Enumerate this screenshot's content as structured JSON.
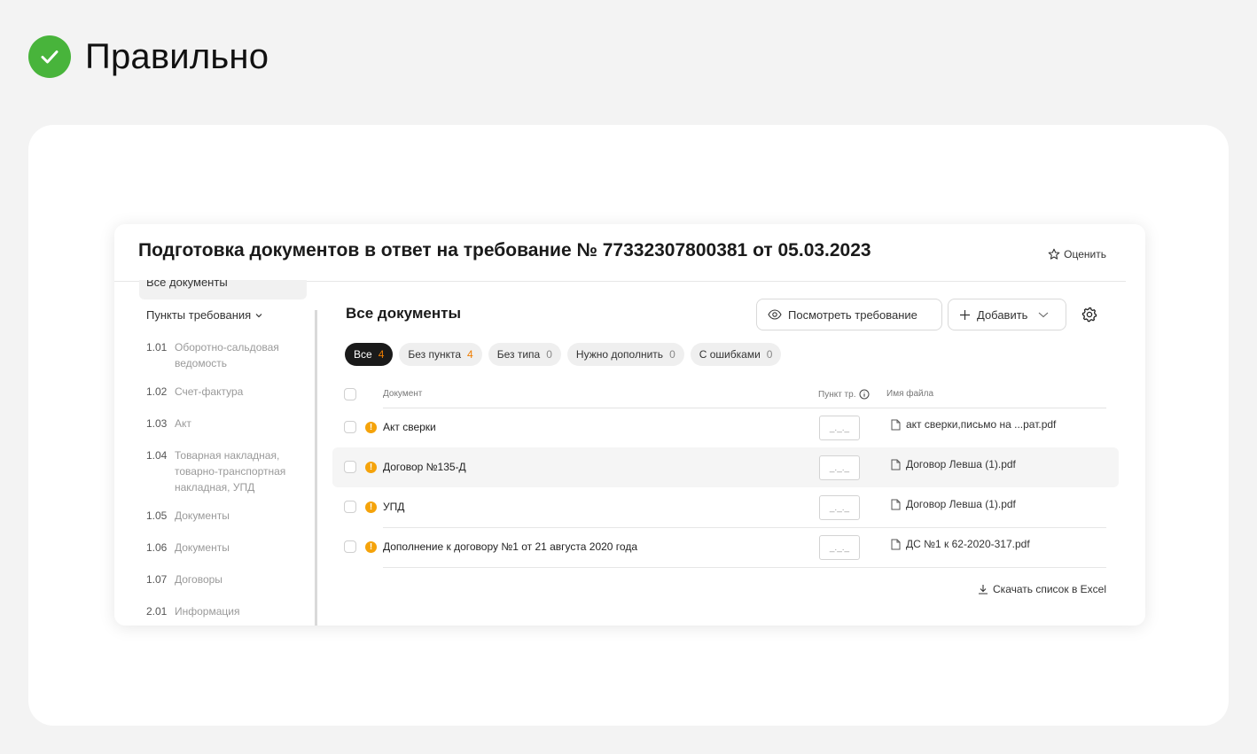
{
  "page": {
    "heading": "Правильно",
    "badge_icon": "check-icon",
    "badge_color": "#48b43b"
  },
  "window": {
    "title": "Подготовка документов в ответ на требование № 77332307800381 от 05.03.2023",
    "rate_label": "Оценить"
  },
  "sidebar": {
    "top_item": "Все документы",
    "section_label": "Пункты требования",
    "items": [
      {
        "num": "1.01",
        "label": "Оборотно-сальдовая ведомость"
      },
      {
        "num": "1.02",
        "label": "Счет-фактура"
      },
      {
        "num": "1.03",
        "label": "Акт"
      },
      {
        "num": "1.04",
        "label": "Товарная накладная, товарно-транспортная накладная, УПД"
      },
      {
        "num": "1.05",
        "label": "Документы"
      },
      {
        "num": "1.06",
        "label": "Документы"
      },
      {
        "num": "1.07",
        "label": "Договоры"
      },
      {
        "num": "2.01",
        "label": "Информация"
      }
    ]
  },
  "main": {
    "title": "Все документы",
    "view_button": "Посмотреть требование",
    "add_button": "Добавить",
    "filters": [
      {
        "label": "Все",
        "count": "4"
      },
      {
        "label": "Без пункта",
        "count": "4"
      },
      {
        "label": "Без типа",
        "count": "0"
      },
      {
        "label": "Нужно дополнить",
        "count": "0"
      },
      {
        "label": "С ошибками",
        "count": "0"
      }
    ],
    "columns": {
      "document": "Документ",
      "punkt": "Пункт тр.",
      "filename": "Имя файла"
    },
    "rows": [
      {
        "document": "Акт сверки",
        "punkt": "_._._",
        "filename": "акт сверки,письмо на ...рат.pdf"
      },
      {
        "document": "Договор №135-Д",
        "punkt": "_._._",
        "filename": "Договор Левша (1).pdf"
      },
      {
        "document": "УПД",
        "punkt": "_._._",
        "filename": "Договор Левша (1).pdf"
      },
      {
        "document": "Дополнение к договору №1 от 21 августа 2020 года",
        "punkt": "_._._",
        "filename": "ДС №1 к 62-2020-317.pdf"
      }
    ],
    "warn_symbol": "!",
    "excel_link": "Скачать список в Excel",
    "accent_orange": "#ef7d00"
  }
}
